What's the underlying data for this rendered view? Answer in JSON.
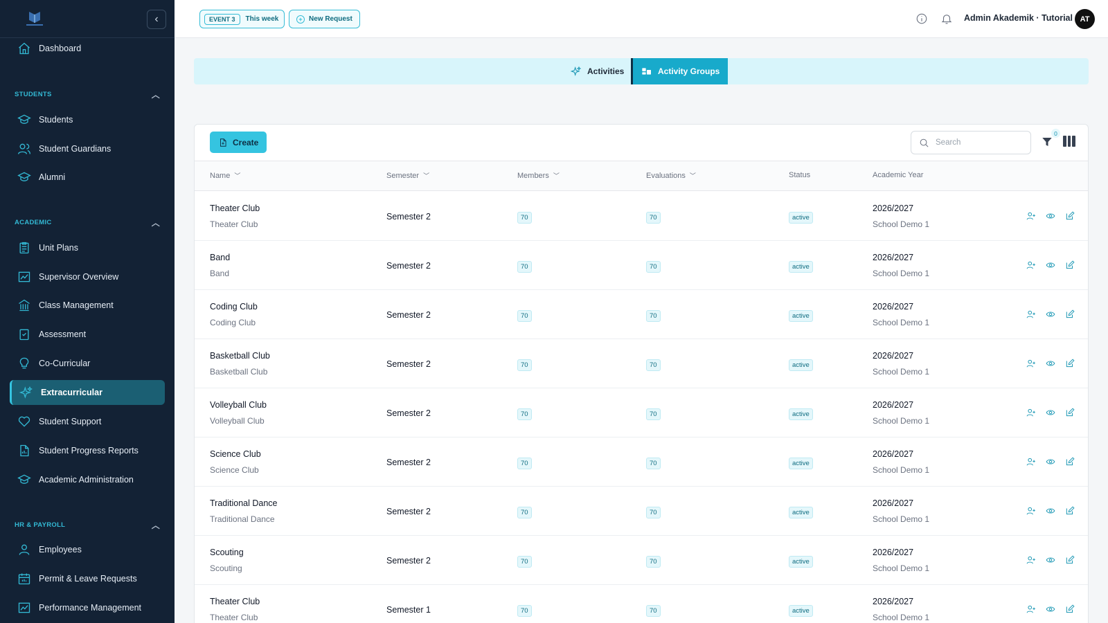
{
  "sidebar": {
    "items": [
      {
        "label": "Dashboard",
        "icon": "home-icon"
      },
      {
        "label": "Students",
        "icon": "graduation-cap-icon"
      },
      {
        "label": "Student Guardians",
        "icon": "users-icon"
      },
      {
        "label": "Alumni",
        "icon": "graduation-cap-icon"
      },
      {
        "label": "Unit Plans",
        "icon": "clipboard-icon"
      },
      {
        "label": "Supervisor Overview",
        "icon": "chart-icon"
      },
      {
        "label": "Class Management",
        "icon": "building-icon"
      },
      {
        "label": "Assessment",
        "icon": "checklist-icon"
      },
      {
        "label": "Co-Curricular",
        "icon": "lightbulb-icon"
      },
      {
        "label": "Extracurricular",
        "icon": "sparkles-icon"
      },
      {
        "label": "Student Support",
        "icon": "heart-icon"
      },
      {
        "label": "Student Progress Reports",
        "icon": "report-icon"
      },
      {
        "label": "Academic Administration",
        "icon": "graduation-cap-icon"
      },
      {
        "label": "Employees",
        "icon": "user-icon"
      },
      {
        "label": "Permit & Leave Requests",
        "icon": "calendar-icon"
      },
      {
        "label": "Performance Management",
        "icon": "chart-icon"
      }
    ],
    "sections": {
      "students": "STUDENTS",
      "academic": "ACADEMIC",
      "hr": "HR & PAYROLL"
    },
    "active_item": "Extracurricular"
  },
  "header": {
    "event_tag": "EVENT 3",
    "event_label": "This week",
    "new_request_label": "New Request",
    "user_name": "Admin Akademik · Tutorial",
    "avatar_initials": "AT"
  },
  "tabs": {
    "activities": "Activities",
    "activity_groups": "Activity Groups",
    "active": "Activity Groups"
  },
  "toolbar": {
    "create_label": "Create",
    "search_placeholder": "Search",
    "filter_count": "0"
  },
  "table": {
    "columns": {
      "name": "Name",
      "semester": "Semester",
      "members": "Members",
      "evaluations": "Evaluations",
      "status": "Status",
      "academic_year": "Academic Year"
    },
    "rows": [
      {
        "name": "Theater Club",
        "subname": "Theater Club",
        "semester": "Semester 2",
        "members": "70",
        "evaluations": "70",
        "status": "active",
        "year": "2026/2027",
        "school": "School Demo 1"
      },
      {
        "name": "Band",
        "subname": "Band",
        "semester": "Semester 2",
        "members": "70",
        "evaluations": "70",
        "status": "active",
        "year": "2026/2027",
        "school": "School Demo 1"
      },
      {
        "name": "Coding Club",
        "subname": "Coding Club",
        "semester": "Semester 2",
        "members": "70",
        "evaluations": "70",
        "status": "active",
        "year": "2026/2027",
        "school": "School Demo 1"
      },
      {
        "name": "Basketball Club",
        "subname": "Basketball Club",
        "semester": "Semester 2",
        "members": "70",
        "evaluations": "70",
        "status": "active",
        "year": "2026/2027",
        "school": "School Demo 1"
      },
      {
        "name": "Volleyball Club",
        "subname": "Volleyball Club",
        "semester": "Semester 2",
        "members": "70",
        "evaluations": "70",
        "status": "active",
        "year": "2026/2027",
        "school": "School Demo 1"
      },
      {
        "name": "Science Club",
        "subname": "Science Club",
        "semester": "Semester 2",
        "members": "70",
        "evaluations": "70",
        "status": "active",
        "year": "2026/2027",
        "school": "School Demo 1"
      },
      {
        "name": "Traditional Dance",
        "subname": "Traditional Dance",
        "semester": "Semester 2",
        "members": "70",
        "evaluations": "70",
        "status": "active",
        "year": "2026/2027",
        "school": "School Demo 1"
      },
      {
        "name": "Scouting",
        "subname": "Scouting",
        "semester": "Semester 2",
        "members": "70",
        "evaluations": "70",
        "status": "active",
        "year": "2026/2027",
        "school": "School Demo 1"
      },
      {
        "name": "Theater Club",
        "subname": "Theater Club",
        "semester": "Semester 1",
        "members": "70",
        "evaluations": "70",
        "status": "active",
        "year": "2026/2027",
        "school": "School Demo 1"
      }
    ]
  },
  "colors": {
    "sidebar_bg": "#132235",
    "accent": "#35c4e0",
    "tab_active": "#18aacb"
  }
}
